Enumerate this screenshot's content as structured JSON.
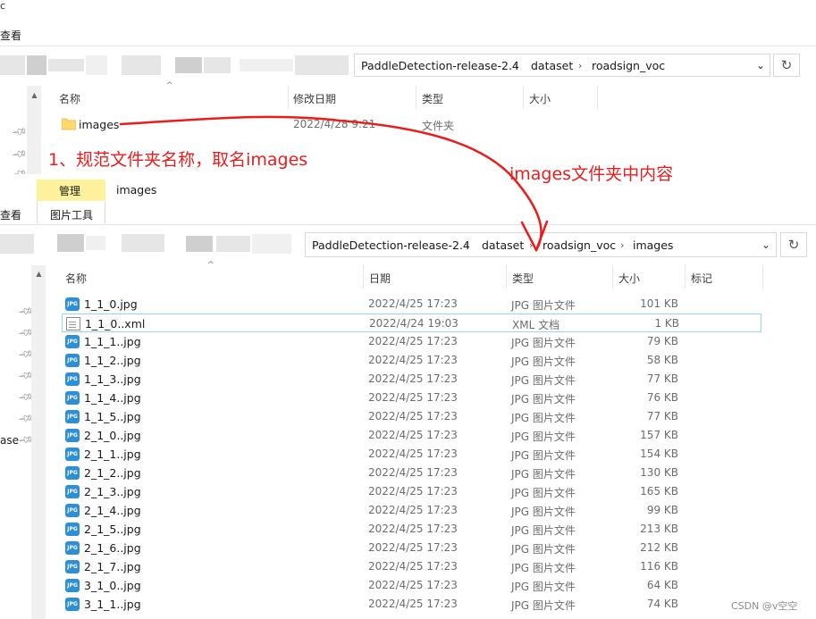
{
  "top_window": {
    "menu_cut_1": "c",
    "menu_cut_2": "查看",
    "breadcrumb": [
      "PaddleDetection-release-2.4",
      "dataset",
      "roadsign_voc"
    ],
    "columns": [
      "名称",
      "修改日期",
      "类型",
      "大小"
    ],
    "rows": [
      {
        "name": "images",
        "date": "2022/4/28 9:21",
        "type": "文件夹",
        "size": ""
      }
    ]
  },
  "bottom_window": {
    "ribbon": {
      "manage_tab": "管理",
      "context_title": "images",
      "picture_tools": "图片工具",
      "view_tab_cut": "查看"
    },
    "breadcrumb": [
      "PaddleDetection-release-2.4",
      "dataset",
      "roadsign_voc",
      "images"
    ],
    "columns": [
      "名称",
      "日期",
      "类型",
      "大小",
      "标记"
    ],
    "nav_cut_label": "ase",
    "rows": [
      {
        "icon": "jpg",
        "name": "1_1_0.jpg",
        "date": "2022/4/25 17:23",
        "type": "JPG 图片文件",
        "size": "101 KB"
      },
      {
        "icon": "xml",
        "name": "1_1_0..xml",
        "date": "2022/4/24 19:03",
        "type": "XML 文档",
        "size": "1 KB",
        "selected": true
      },
      {
        "icon": "jpg",
        "name": "1_1_1..jpg",
        "date": "2022/4/25 17:23",
        "type": "JPG 图片文件",
        "size": "79 KB"
      },
      {
        "icon": "jpg",
        "name": "1_1_2..jpg",
        "date": "2022/4/25 17:23",
        "type": "JPG 图片文件",
        "size": "58 KB"
      },
      {
        "icon": "jpg",
        "name": "1_1_3..jpg",
        "date": "2022/4/25 17:23",
        "type": "JPG 图片文件",
        "size": "77 KB"
      },
      {
        "icon": "jpg",
        "name": "1_1_4..jpg",
        "date": "2022/4/25 17:23",
        "type": "JPG 图片文件",
        "size": "76 KB"
      },
      {
        "icon": "jpg",
        "name": "1_1_5..jpg",
        "date": "2022/4/25 17:23",
        "type": "JPG 图片文件",
        "size": "77 KB"
      },
      {
        "icon": "jpg",
        "name": "2_1_0..jpg",
        "date": "2022/4/25 17:23",
        "type": "JPG 图片文件",
        "size": "157 KB"
      },
      {
        "icon": "jpg",
        "name": "2_1_1..jpg",
        "date": "2022/4/25 17:23",
        "type": "JPG 图片文件",
        "size": "154 KB"
      },
      {
        "icon": "jpg",
        "name": "2_1_2..jpg",
        "date": "2022/4/25 17:23",
        "type": "JPG 图片文件",
        "size": "130 KB"
      },
      {
        "icon": "jpg",
        "name": "2_1_3..jpg",
        "date": "2022/4/25 17:23",
        "type": "JPG 图片文件",
        "size": "165 KB"
      },
      {
        "icon": "jpg",
        "name": "2_1_4..jpg",
        "date": "2022/4/25 17:23",
        "type": "JPG 图片文件",
        "size": "99 KB"
      },
      {
        "icon": "jpg",
        "name": "2_1_5..jpg",
        "date": "2022/4/25 17:23",
        "type": "JPG 图片文件",
        "size": "213 KB"
      },
      {
        "icon": "jpg",
        "name": "2_1_6..jpg",
        "date": "2022/4/25 17:23",
        "type": "JPG 图片文件",
        "size": "212 KB"
      },
      {
        "icon": "jpg",
        "name": "2_1_7..jpg",
        "date": "2022/4/25 17:23",
        "type": "JPG 图片文件",
        "size": "116 KB"
      },
      {
        "icon": "jpg",
        "name": "3_1_0..jpg",
        "date": "2022/4/25 17:23",
        "type": "JPG 图片文件",
        "size": "64 KB"
      },
      {
        "icon": "jpg",
        "name": "3_1_1..jpg",
        "date": "2022/4/25 17:23",
        "type": "JPG 图片文件",
        "size": "74 KB"
      }
    ]
  },
  "annotations": {
    "note_1": "1、规范文件夹名称，取名images",
    "note_2": "images文件夹中内容",
    "color": "#ea1d1d"
  },
  "watermark": "CSDN @v空空",
  "icons": [
    "folder-icon",
    "jpg-file-icon",
    "xml-file-icon",
    "pin-icon",
    "chevron-down-icon",
    "refresh-icon",
    "sort-up-icon",
    "scroll-up-icon"
  ]
}
